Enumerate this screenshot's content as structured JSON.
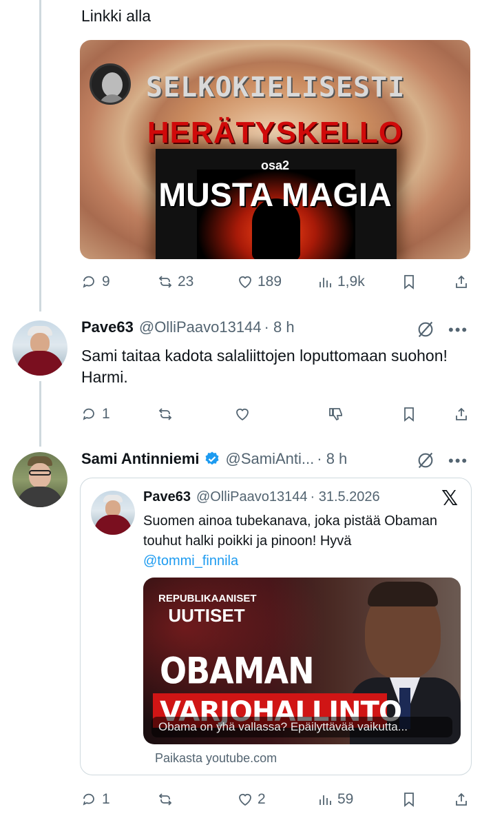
{
  "post1": {
    "text": "Linkki alla",
    "thumb": {
      "channel_title": "SELKOKIELISESTI",
      "title_red": "HERÄTYSKELLO",
      "part": "osa2",
      "title_white": "MUSTA MAGIA"
    },
    "stats": {
      "replies": "9",
      "reposts": "23",
      "likes": "189",
      "views": "1,9k"
    }
  },
  "post2": {
    "name": "Pave63",
    "handle": "@OlliPaavo13144",
    "time": "· 8 h",
    "text": "Sami taitaa kadota salaliittojen loputtomaan suohon! Harmi.",
    "stats": {
      "replies": "1"
    }
  },
  "post3": {
    "name": "Sami Antinniemi",
    "handle": "@SamiAnti...",
    "time": "· 8 h",
    "quoted": {
      "name": "Pave63",
      "handle": "@OlliPaavo13144",
      "date": "· 31.5.2026",
      "text": "Suomen ainoa tubekanava, joka pistää Obaman touhut halki poikki ja pinoon! Hyvä",
      "mention": "@tommi_finnila",
      "video": {
        "tag_line1": "REPUBLIKAANISET",
        "tag_line2": "UUTISET",
        "headline1": "OBAMAN",
        "headline2": "VARJOHALLINTO",
        "caption": "Obama on yhä vallassa? Epäilyttävää vaikutta..."
      },
      "source": "Paikasta youtube.com"
    },
    "stats": {
      "replies": "1",
      "likes": "2",
      "views": "59"
    }
  },
  "colors": {
    "accent": "#1d9bf0",
    "muted": "#536471",
    "verified": "#1d9bf0",
    "divider": "#cfd9de"
  }
}
